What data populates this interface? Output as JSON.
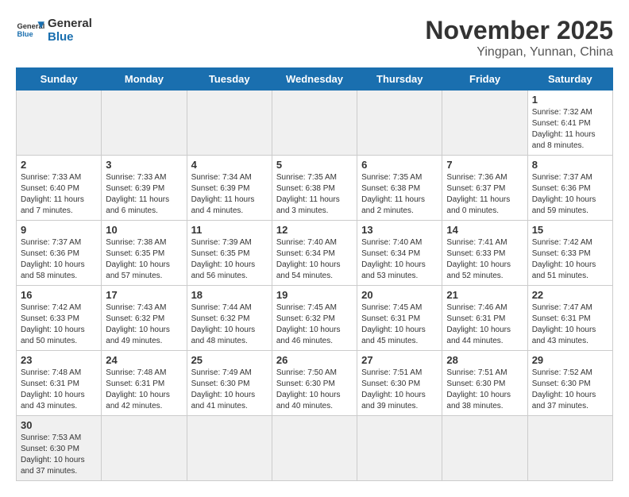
{
  "header": {
    "logo_general": "General",
    "logo_blue": "Blue",
    "month_title": "November 2025",
    "location": "Yingpan, Yunnan, China"
  },
  "days_of_week": [
    "Sunday",
    "Monday",
    "Tuesday",
    "Wednesday",
    "Thursday",
    "Friday",
    "Saturday"
  ],
  "weeks": [
    [
      {
        "date": "",
        "text": ""
      },
      {
        "date": "",
        "text": ""
      },
      {
        "date": "",
        "text": ""
      },
      {
        "date": "",
        "text": ""
      },
      {
        "date": "",
        "text": ""
      },
      {
        "date": "",
        "text": ""
      },
      {
        "date": "1",
        "text": "Sunrise: 7:32 AM\nSunset: 6:41 PM\nDaylight: 11 hours and 8 minutes."
      }
    ],
    [
      {
        "date": "2",
        "text": "Sunrise: 7:33 AM\nSunset: 6:40 PM\nDaylight: 11 hours and 7 minutes."
      },
      {
        "date": "3",
        "text": "Sunrise: 7:33 AM\nSunset: 6:39 PM\nDaylight: 11 hours and 6 minutes."
      },
      {
        "date": "4",
        "text": "Sunrise: 7:34 AM\nSunset: 6:39 PM\nDaylight: 11 hours and 4 minutes."
      },
      {
        "date": "5",
        "text": "Sunrise: 7:35 AM\nSunset: 6:38 PM\nDaylight: 11 hours and 3 minutes."
      },
      {
        "date": "6",
        "text": "Sunrise: 7:35 AM\nSunset: 6:38 PM\nDaylight: 11 hours and 2 minutes."
      },
      {
        "date": "7",
        "text": "Sunrise: 7:36 AM\nSunset: 6:37 PM\nDaylight: 11 hours and 0 minutes."
      },
      {
        "date": "8",
        "text": "Sunrise: 7:37 AM\nSunset: 6:36 PM\nDaylight: 10 hours and 59 minutes."
      }
    ],
    [
      {
        "date": "9",
        "text": "Sunrise: 7:37 AM\nSunset: 6:36 PM\nDaylight: 10 hours and 58 minutes."
      },
      {
        "date": "10",
        "text": "Sunrise: 7:38 AM\nSunset: 6:35 PM\nDaylight: 10 hours and 57 minutes."
      },
      {
        "date": "11",
        "text": "Sunrise: 7:39 AM\nSunset: 6:35 PM\nDaylight: 10 hours and 56 minutes."
      },
      {
        "date": "12",
        "text": "Sunrise: 7:40 AM\nSunset: 6:34 PM\nDaylight: 10 hours and 54 minutes."
      },
      {
        "date": "13",
        "text": "Sunrise: 7:40 AM\nSunset: 6:34 PM\nDaylight: 10 hours and 53 minutes."
      },
      {
        "date": "14",
        "text": "Sunrise: 7:41 AM\nSunset: 6:33 PM\nDaylight: 10 hours and 52 minutes."
      },
      {
        "date": "15",
        "text": "Sunrise: 7:42 AM\nSunset: 6:33 PM\nDaylight: 10 hours and 51 minutes."
      }
    ],
    [
      {
        "date": "16",
        "text": "Sunrise: 7:42 AM\nSunset: 6:33 PM\nDaylight: 10 hours and 50 minutes."
      },
      {
        "date": "17",
        "text": "Sunrise: 7:43 AM\nSunset: 6:32 PM\nDaylight: 10 hours and 49 minutes."
      },
      {
        "date": "18",
        "text": "Sunrise: 7:44 AM\nSunset: 6:32 PM\nDaylight: 10 hours and 48 minutes."
      },
      {
        "date": "19",
        "text": "Sunrise: 7:45 AM\nSunset: 6:32 PM\nDaylight: 10 hours and 46 minutes."
      },
      {
        "date": "20",
        "text": "Sunrise: 7:45 AM\nSunset: 6:31 PM\nDaylight: 10 hours and 45 minutes."
      },
      {
        "date": "21",
        "text": "Sunrise: 7:46 AM\nSunset: 6:31 PM\nDaylight: 10 hours and 44 minutes."
      },
      {
        "date": "22",
        "text": "Sunrise: 7:47 AM\nSunset: 6:31 PM\nDaylight: 10 hours and 43 minutes."
      }
    ],
    [
      {
        "date": "23",
        "text": "Sunrise: 7:48 AM\nSunset: 6:31 PM\nDaylight: 10 hours and 43 minutes."
      },
      {
        "date": "24",
        "text": "Sunrise: 7:48 AM\nSunset: 6:31 PM\nDaylight: 10 hours and 42 minutes."
      },
      {
        "date": "25",
        "text": "Sunrise: 7:49 AM\nSunset: 6:30 PM\nDaylight: 10 hours and 41 minutes."
      },
      {
        "date": "26",
        "text": "Sunrise: 7:50 AM\nSunset: 6:30 PM\nDaylight: 10 hours and 40 minutes."
      },
      {
        "date": "27",
        "text": "Sunrise: 7:51 AM\nSunset: 6:30 PM\nDaylight: 10 hours and 39 minutes."
      },
      {
        "date": "28",
        "text": "Sunrise: 7:51 AM\nSunset: 6:30 PM\nDaylight: 10 hours and 38 minutes."
      },
      {
        "date": "29",
        "text": "Sunrise: 7:52 AM\nSunset: 6:30 PM\nDaylight: 10 hours and 37 minutes."
      }
    ],
    [
      {
        "date": "30",
        "text": "Sunrise: 7:53 AM\nSunset: 6:30 PM\nDaylight: 10 hours and 37 minutes."
      },
      {
        "date": "",
        "text": ""
      },
      {
        "date": "",
        "text": ""
      },
      {
        "date": "",
        "text": ""
      },
      {
        "date": "",
        "text": ""
      },
      {
        "date": "",
        "text": ""
      },
      {
        "date": "",
        "text": ""
      }
    ]
  ]
}
